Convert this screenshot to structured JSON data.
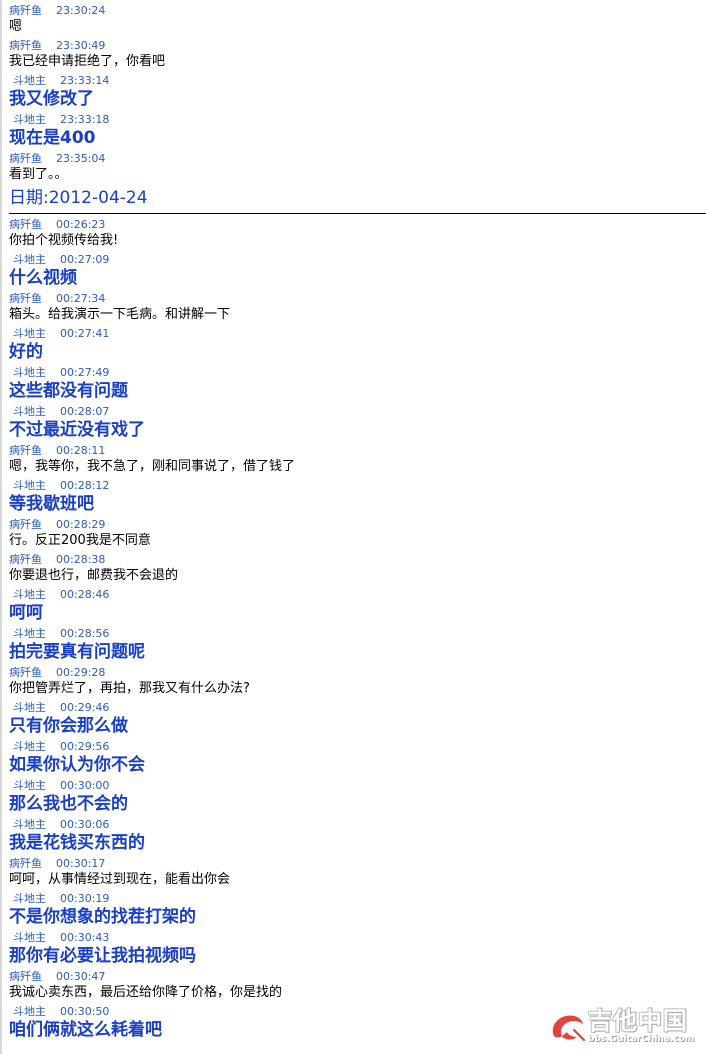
{
  "messages_before": [
    {
      "sender": "病歼鱼",
      "time": "23:30:24",
      "text": "嗯",
      "side": "a"
    },
    {
      "sender": "病歼鱼",
      "time": "23:30:49",
      "text": "我已经申请拒绝了，你看吧",
      "side": "a"
    },
    {
      "sender": "斗地主",
      "time": "23:33:14",
      "text": "我又修改了",
      "side": "b"
    },
    {
      "sender": "斗地主",
      "time": "23:33:18",
      "text": "现在是400",
      "side": "b"
    },
    {
      "sender": "病歼鱼",
      "time": "23:35:04",
      "text": "看到了。。",
      "side": "a"
    }
  ],
  "date_separator": "日期:2012-04-24",
  "messages_after": [
    {
      "sender": "病歼鱼",
      "time": "00:26:23",
      "text": "你拍个视频传给我!",
      "side": "a"
    },
    {
      "sender": "斗地主",
      "time": "00:27:09",
      "text": "什么视频",
      "side": "b"
    },
    {
      "sender": "病歼鱼",
      "time": "00:27:34",
      "text": "箱头。给我演示一下毛病。和讲解一下",
      "side": "a"
    },
    {
      "sender": "斗地主",
      "time": "00:27:41",
      "text": "好的",
      "side": "b"
    },
    {
      "sender": "斗地主",
      "time": "00:27:49",
      "text": "这些都没有问题",
      "side": "b"
    },
    {
      "sender": "斗地主",
      "time": "00:28:07",
      "text": "不过最近没有戏了",
      "side": "b"
    },
    {
      "sender": "病歼鱼",
      "time": "00:28:11",
      "text": "嗯，我等你，我不急了，刚和同事说了，借了钱了",
      "side": "a"
    },
    {
      "sender": "斗地主",
      "time": "00:28:12",
      "text": "等我歇班吧",
      "side": "b"
    },
    {
      "sender": "病歼鱼",
      "time": "00:28:29",
      "text": "行。反正200我是不同意",
      "side": "a"
    },
    {
      "sender": "病歼鱼",
      "time": "00:28:38",
      "text": "你要退也行，邮费我不会退的",
      "side": "a"
    },
    {
      "sender": "斗地主",
      "time": "00:28:46",
      "text": "呵呵",
      "side": "b"
    },
    {
      "sender": "斗地主",
      "time": "00:28:56",
      "text": "拍完要真有问题呢",
      "side": "b"
    },
    {
      "sender": "病歼鱼",
      "time": "00:29:28",
      "text": "你把管弄烂了，再拍，那我又有什么办法?",
      "side": "a"
    },
    {
      "sender": "斗地主",
      "time": "00:29:46",
      "text": "只有你会那么做",
      "side": "b"
    },
    {
      "sender": "斗地主",
      "time": "00:29:56",
      "text": "如果你认为你不会",
      "side": "b"
    },
    {
      "sender": "斗地主",
      "time": "00:30:00",
      "text": "那么我也不会的",
      "side": "b"
    },
    {
      "sender": "斗地主",
      "time": "00:30:06",
      "text": "我是花钱买东西的",
      "side": "b"
    },
    {
      "sender": "病歼鱼",
      "time": "00:30:17",
      "text": "呵呵，从事情经过到现在，能看出你会",
      "side": "a"
    },
    {
      "sender": "斗地主",
      "time": "00:30:19",
      "text": "不是你想象的找茬打架的",
      "side": "b"
    },
    {
      "sender": "斗地主",
      "time": "00:30:43",
      "text": "那你有必要让我拍视频吗",
      "side": "b"
    },
    {
      "sender": "病歼鱼",
      "time": "00:30:47",
      "text": "我诚心卖东西，最后还给你降了价格，你是找的",
      "side": "a"
    },
    {
      "sender": "斗地主",
      "time": "00:30:50",
      "text": "咱们俩就这么耗着吧",
      "side": "b"
    }
  ],
  "watermark": {
    "name": "吉他中国",
    "url": "bbs.GuitarChina.com"
  },
  "colors": {
    "header": "#2c5bbf",
    "sender_b_text": "#1a3fc7",
    "sender_a_text": "#000000",
    "divider": "#000000"
  }
}
